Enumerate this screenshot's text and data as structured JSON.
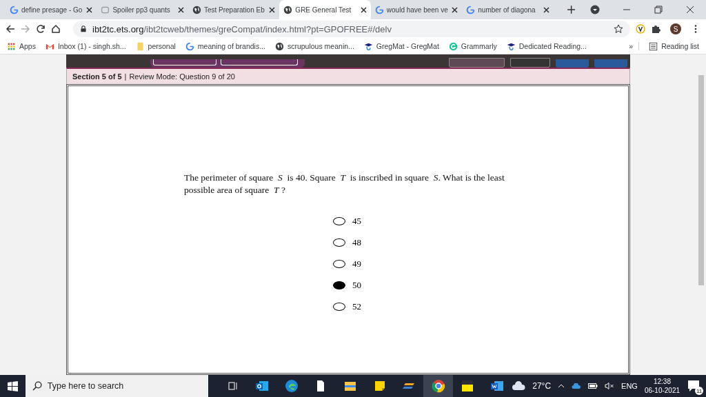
{
  "tabs": [
    {
      "title": "define presage - Go",
      "kind": "google",
      "selected": false
    },
    {
      "title": "Spoiler pp3 quants",
      "kind": "page",
      "selected": false
    },
    {
      "title": "Test Preparation Eb",
      "kind": "globe",
      "selected": false
    },
    {
      "title": "GRE General Test",
      "kind": "globe",
      "selected": true
    },
    {
      "title": "would have been ve",
      "kind": "google",
      "selected": false
    },
    {
      "title": "number of diagona",
      "kind": "google",
      "selected": false
    }
  ],
  "address_bar": {
    "host": "ibt2tc.ets.org",
    "path": "/ibt2tcweb/themes/greCompat/index.html?pt=GPOFREE#/delv"
  },
  "profile": {
    "initial": "S"
  },
  "bookmarks": [
    {
      "label": "Apps",
      "kind": "apps"
    },
    {
      "label": "Inbox (1) - singh.sh...",
      "kind": "gmail"
    },
    {
      "label": "personal",
      "kind": "folder"
    },
    {
      "label": "meaning of brandis...",
      "kind": "google"
    },
    {
      "label": "scrupulous meanin...",
      "kind": "globe"
    },
    {
      "label": "GregMat - GregMat",
      "kind": "cap"
    },
    {
      "label": "Grammarly",
      "kind": "grammarly"
    },
    {
      "label": "Dedicated Reading...",
      "kind": "cap"
    }
  ],
  "overflow": "»",
  "reading_list": "Reading list",
  "section_bar": {
    "section": "Section 5 of 5",
    "separator": "|",
    "mode": "Review Mode: Question 9 of 20"
  },
  "question": "The perimeter of square  *S*  is 40. Square  *T*  is inscribed in square  *S*. What is the least possible area of square  *T* ?",
  "options": [
    {
      "label": "45",
      "selected": false
    },
    {
      "label": "48",
      "selected": false
    },
    {
      "label": "49",
      "selected": false
    },
    {
      "label": "50",
      "selected": true
    },
    {
      "label": "52",
      "selected": false
    }
  ],
  "taskbar": {
    "search_placeholder": "Type here to search",
    "weather": "27°C",
    "language": "ENG",
    "time": "12:38",
    "date": "06-10-2021",
    "notifications": "11"
  }
}
